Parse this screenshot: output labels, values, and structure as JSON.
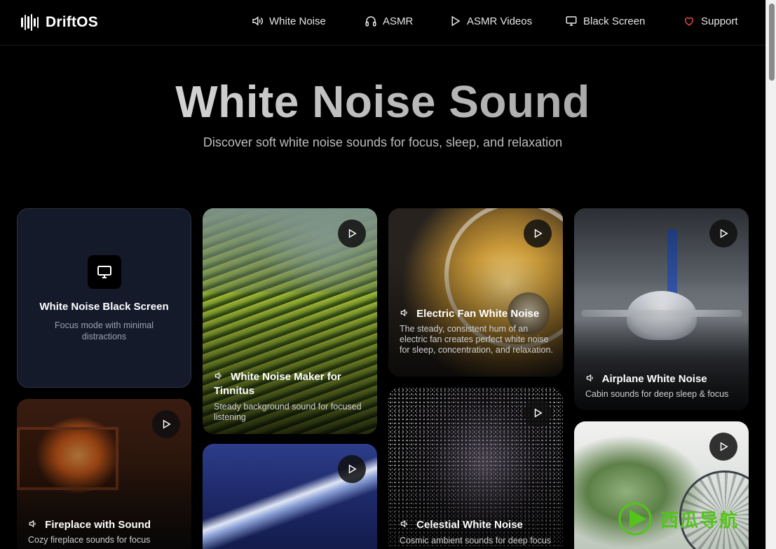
{
  "brand": {
    "name": "DriftOS"
  },
  "nav": [
    {
      "label": "White Noise",
      "icon": "speaker-icon"
    },
    {
      "label": "ASMR",
      "icon": "headphones-icon"
    },
    {
      "label": "ASMR Videos",
      "icon": "play-icon"
    },
    {
      "label": "Black Screen",
      "icon": "monitor-icon"
    },
    {
      "label": "Support",
      "icon": "heart-icon"
    }
  ],
  "hero": {
    "title": "White Noise Sound",
    "subtitle": "Discover soft white noise sounds for focus, sleep, and relaxation"
  },
  "cards": {
    "black_screen": {
      "title": "White Noise Black Screen",
      "desc": "Focus mode with minimal distractions"
    },
    "tinnitus": {
      "title": "White Noise Maker for Tinnitus",
      "desc": "Steady background sound for focused listening"
    },
    "fan": {
      "title": "Electric Fan White Noise",
      "desc": "The steady, consistent hum of an electric fan creates perfect white noise for sleep, concentration, and relaxation."
    },
    "airplane": {
      "title": "Airplane White Noise",
      "desc": "Cabin sounds for deep sleep & focus"
    },
    "fireplace": {
      "title": "Fireplace with Sound",
      "desc": "Cozy fireplace sounds for focus"
    },
    "celestial": {
      "title": "Celestial White Noise",
      "desc": "Cosmic ambient sounds for deep focus"
    }
  },
  "watermark": {
    "text": "西瓜导航"
  },
  "colors": {
    "background": "#000000",
    "card_dark": "#141a2a",
    "heart": "#e5484d",
    "watermark": "#53c41a"
  }
}
